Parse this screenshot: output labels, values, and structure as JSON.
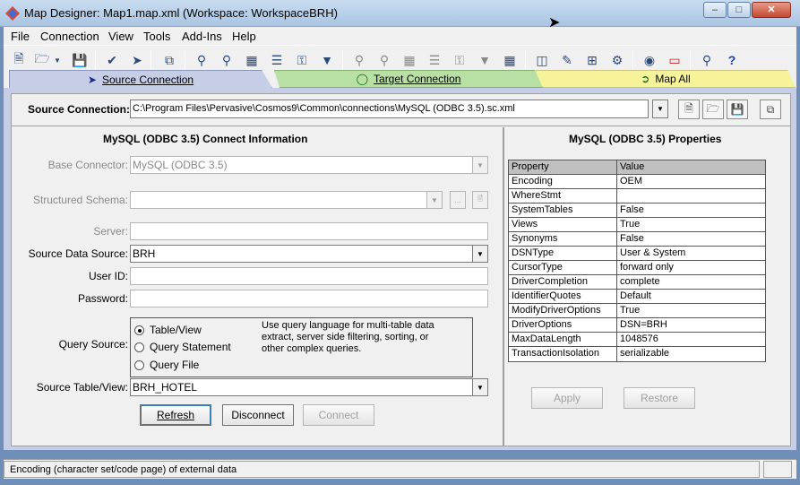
{
  "window": {
    "title": "Map Designer: Map1.map.xml (Workspace: WorkspaceBRH)"
  },
  "menu": [
    "File",
    "Connection",
    "View",
    "Tools",
    "Add-Ins",
    "Help"
  ],
  "tabs": {
    "source": "Source Connection",
    "target": "Target Connection",
    "mapall": "Map All"
  },
  "source_connection": {
    "label": "Source Connection:",
    "path": "C:\\Program Files\\Pervasive\\Cosmos9\\Common\\connections\\MySQL (ODBC 3.5).sc.xml"
  },
  "connect_info": {
    "title": "MySQL (ODBC 3.5) Connect Information",
    "base_connector_label": "Base Connector:",
    "base_connector_value": "MySQL (ODBC 3.5)",
    "structured_schema_label": "Structured Schema:",
    "server_label": "Server:",
    "source_data_source_label": "Source Data Source:",
    "source_data_source_value": "BRH",
    "user_id_label": "User ID:",
    "password_label": "Password:",
    "query_source_label": "Query Source:",
    "query_options": [
      "Table/View",
      "Query Statement",
      "Query File"
    ],
    "query_note": "Use query language for multi-table data extract, server side filtering, sorting, or other complex queries.",
    "source_table_label": "Source Table/View:",
    "source_table_value": "BRH_HOTEL",
    "buttons": {
      "refresh": "Refresh",
      "disconnect": "Disconnect",
      "connect": "Connect"
    }
  },
  "properties": {
    "title": "MySQL (ODBC 3.5) Properties",
    "headers": [
      "Property",
      "Value"
    ],
    "rows": [
      [
        "Encoding",
        "OEM"
      ],
      [
        "WhereStmt",
        ""
      ],
      [
        "SystemTables",
        "False"
      ],
      [
        "Views",
        "True"
      ],
      [
        "Synonyms",
        "False"
      ],
      [
        "DSNType",
        "User & System"
      ],
      [
        "CursorType",
        "forward only"
      ],
      [
        "DriverCompletion",
        "complete"
      ],
      [
        "IdentifierQuotes",
        "Default"
      ],
      [
        "ModifyDriverOptions",
        "True"
      ],
      [
        "DriverOptions",
        "DSN=BRH"
      ],
      [
        "MaxDataLength",
        "1048576"
      ],
      [
        "TransactionIsolation",
        "serializable"
      ]
    ],
    "buttons": {
      "apply": "Apply",
      "restore": "Restore"
    }
  },
  "status": {
    "text": "Encoding (character set/code page) of external data"
  },
  "colors": {
    "source_tab": "#c6cde6",
    "target_tab": "#b8e0a4",
    "mapall_tab": "#f6f39a"
  }
}
